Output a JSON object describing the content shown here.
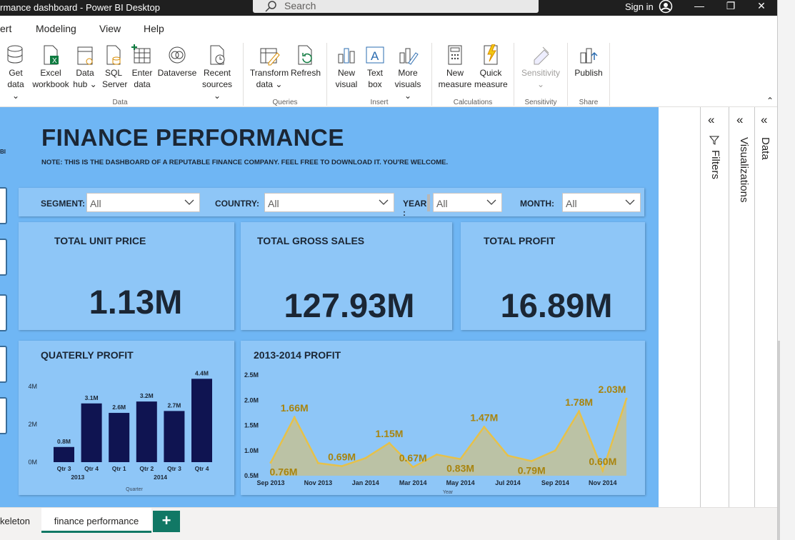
{
  "window": {
    "title": "rmance dashboard - Power BI Desktop",
    "search_placeholder": "Search",
    "sign_in": "Sign in",
    "minimize": "—",
    "restore": "❐",
    "close": "✕"
  },
  "menu": [
    "ert",
    "Modeling",
    "View",
    "Help"
  ],
  "ribbon": {
    "get_data": [
      "Get",
      "data ⌄"
    ],
    "excel": [
      "Excel",
      "workbook"
    ],
    "data_hub": [
      "Data",
      "hub ⌄"
    ],
    "sql": [
      "SQL",
      "Server"
    ],
    "enter_data": [
      "Enter",
      "data"
    ],
    "dataverse": "Dataverse",
    "recent": [
      "Recent",
      "sources ⌄"
    ],
    "transform": [
      "Transform",
      "data ⌄"
    ],
    "refresh": "Refresh",
    "new_visual": [
      "New",
      "visual"
    ],
    "text_box": [
      "Text",
      "box"
    ],
    "more_visuals": [
      "More",
      "visuals ⌄"
    ],
    "new_measure": [
      "New",
      "measure"
    ],
    "quick_measure": [
      "Quick",
      "measure"
    ],
    "sensitivity": [
      "Sensitivity",
      "⌄"
    ],
    "publish": "Publish",
    "groups": [
      "Data",
      "Queries",
      "Insert",
      "Calculations",
      "Sensitivity",
      "Share"
    ],
    "collapse": "⌃"
  },
  "panes": {
    "filters": "Filters",
    "visualizations": "Visualizations",
    "data": "Data",
    "chevron": "«"
  },
  "report": {
    "left_stub": "BI",
    "title": "FINANCE PERFORMANCE",
    "note": "NOTE: THIS IS THE DASHBOARD OF A REPUTABLE FINANCE COMPANY. FEEL FREE TO DOWNLOAD IT. YOU'RE WELCOME.",
    "slicers": [
      {
        "label": "SEGMENT:",
        "value": "All"
      },
      {
        "label": "COUNTRY:",
        "value": "All"
      },
      {
        "label": "YEAR",
        "label2": ":",
        "value": "All"
      },
      {
        "label": "MONTH:",
        "value": "All"
      }
    ],
    "cards": [
      {
        "title": "TOTAL UNIT PRICE",
        "value": "1.13M"
      },
      {
        "title": "TOTAL GROSS SALES",
        "value": "127.93M"
      },
      {
        "title": "TOTAL PROFIT",
        "value": "16.89M"
      }
    ]
  },
  "chart_data": [
    {
      "type": "bar",
      "title": "QUATERLY PROFIT",
      "xlabel": "Quarter",
      "ylabel": "",
      "categories": [
        "Qtr 3",
        "Qtr 4",
        "Qtr 1",
        "Qtr 2",
        "Qtr 3",
        "Qtr 4"
      ],
      "category_groups": [
        {
          "label": "2013",
          "span": [
            0,
            1
          ]
        },
        {
          "label": "2014",
          "span": [
            2,
            5
          ]
        }
      ],
      "values": [
        0.8,
        3.1,
        2.6,
        3.2,
        2.7,
        4.4
      ],
      "data_labels": [
        "0.8M",
        "3.1M",
        "2.6M",
        "3.2M",
        "2.7M",
        "4.4M"
      ],
      "y_ticks": [
        {
          "v": 0,
          "label": "0M"
        },
        {
          "v": 2,
          "label": "2M"
        },
        {
          "v": 4,
          "label": "4M"
        }
      ],
      "ylim": [
        0,
        4.6
      ],
      "unit": "M",
      "color": "#0f1451"
    },
    {
      "type": "area",
      "title": "2013-2014 PROFIT",
      "xlabel": "Year",
      "ylabel": "",
      "x": [
        "Sep 2013",
        "Oct 2013",
        "Nov 2013",
        "Dec 2013",
        "Jan 2014",
        "Feb 2014",
        "Mar 2014",
        "Apr 2014",
        "May 2014",
        "Jun 2014",
        "Jul 2014",
        "Aug 2014",
        "Sep 2014",
        "Oct 2014",
        "Nov 2014",
        "Dec 2014"
      ],
      "x_tick_labels": [
        "Sep 2013",
        "Nov 2013",
        "Jan 2014",
        "Mar 2014",
        "May 2014",
        "Jul 2014",
        "Sep 2014",
        "Nov 2014"
      ],
      "values": [
        0.76,
        1.66,
        0.75,
        0.69,
        0.85,
        1.15,
        0.67,
        0.92,
        0.83,
        1.47,
        0.9,
        0.79,
        1.0,
        1.78,
        0.6,
        2.03
      ],
      "annotations": [
        {
          "i": 0,
          "label": "0.76M",
          "pos": "below"
        },
        {
          "i": 1,
          "label": "1.66M",
          "pos": "above"
        },
        {
          "i": 3,
          "label": "0.69M",
          "pos": "above"
        },
        {
          "i": 5,
          "label": "1.15M",
          "pos": "above"
        },
        {
          "i": 6,
          "label": "0.67M",
          "pos": "above"
        },
        {
          "i": 8,
          "label": "0.83M",
          "pos": "below"
        },
        {
          "i": 9,
          "label": "1.47M",
          "pos": "above"
        },
        {
          "i": 11,
          "label": "0.79M",
          "pos": "below"
        },
        {
          "i": 13,
          "label": "1.78M",
          "pos": "above"
        },
        {
          "i": 14,
          "label": "0.60M",
          "pos": "above"
        },
        {
          "i": 15,
          "label": "2.03M",
          "pos": "above"
        }
      ],
      "y_ticks": [
        {
          "v": 0.5,
          "label": "0.5M"
        },
        {
          "v": 1.0,
          "label": "1.0M"
        },
        {
          "v": 1.5,
          "label": "1.5M"
        },
        {
          "v": 2.0,
          "label": "2.0M"
        },
        {
          "v": 2.5,
          "label": "2.5M"
        }
      ],
      "ylim": [
        0.5,
        2.5
      ],
      "line_color": "#e6c14a",
      "fill_color": "#c9c08a",
      "label_color": "#a8840e"
    }
  ],
  "tabs": {
    "prev": "keleton",
    "active": "finance performance",
    "add": "+"
  }
}
